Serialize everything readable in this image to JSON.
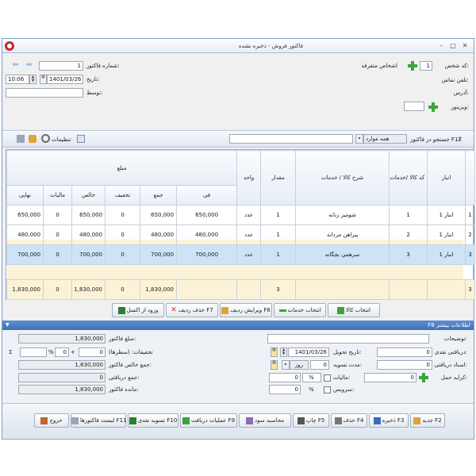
{
  "window": {
    "title": "فاکتور فروش - ذخیره نشده"
  },
  "header": {
    "customer_code_label": "کد شخص:",
    "customer_code_value": "1",
    "customer_name_value": "اشخاص متفرقه",
    "customer_phone_label": "تلفن تماس:",
    "address_label": "آدرس:",
    "visitor_label": "ویزیتور:",
    "invoice_no_label": "شماره فاکتور:",
    "invoice_no_value": "1",
    "date_label": "تاریخ:",
    "date_value": "1401/03/26",
    "time_value": "10:06",
    "by_label": "توسط:"
  },
  "toolbar": {
    "search_label": "جستجو در فاکتور F12",
    "scope_value": "همه موارد",
    "settings_label": "تنظیمات"
  },
  "grid": {
    "group_header": "مبلغ",
    "columns": {
      "warehouse": "انبار",
      "code": "کد کالا /خدمات",
      "desc": "شرح کالا / خدمات",
      "qty": "مقدار",
      "unit": "واحد",
      "fee": "فی",
      "total": "جمع",
      "discount": "تخفیف",
      "net": "خالص",
      "tax": "مالیات",
      "final": "نهایی"
    },
    "rows": [
      {
        "idx": "1",
        "warehouse": "انبار 1",
        "code": "1",
        "desc": "شومیز زنانه",
        "qty": "1",
        "unit": "عدد",
        "fee": "650,000",
        "total": "650,000",
        "discount": "0",
        "net": "650,000",
        "tax": "0",
        "final": "650,000"
      },
      {
        "idx": "2",
        "warehouse": "انبار 1",
        "code": "2",
        "desc": "پیراهن مردانه",
        "qty": "1",
        "unit": "عدد",
        "fee": "480,000",
        "total": "480,000",
        "discount": "0",
        "net": "480,000",
        "tax": "0",
        "final": "480,000"
      },
      {
        "idx": "3",
        "warehouse": "انبار 1",
        "code": "3",
        "desc": "سرهمي بچگانه",
        "qty": "1",
        "unit": "عدد",
        "fee": "700,000",
        "total": "700,000",
        "discount": "0",
        "net": "700,000",
        "tax": "0",
        "final": "700,000"
      }
    ],
    "summary": {
      "count": "3",
      "qty": "3",
      "total": "1,830,000",
      "discount": "0",
      "net": "1,830,000",
      "tax": "0",
      "final": "1,830,000"
    }
  },
  "row_buttons": {
    "select_item": "انتخاب کالا",
    "select_service": "انتخاب خدمات",
    "edit_row": "ویرایش ردیف F6",
    "delete_row": "حذف ردیف F7",
    "import_excel": "ورود از اکسل"
  },
  "more_info": {
    "label": "F8 اطلاعات بیشتر"
  },
  "footer": {
    "description_label": "توضیحات:",
    "cash_label": "دریافتی نقدی:",
    "cash_value": "0",
    "cheque_label": "اسناد دریافتی:",
    "cheque_value": "0",
    "freight_label": "کرایه حمل:",
    "freight_value": "0",
    "delivery_date_label": "تاریخ تحویل:",
    "delivery_date_value": "1401/03/26",
    "settle_label": "مدت تسویه:",
    "settle_value": "0",
    "settle_unit": "روز",
    "tax_label": "مالیات:",
    "tax_value": "0",
    "tax_pct": "%",
    "service_label": "سرویس:",
    "service_value": "0",
    "service_pct": "%",
    "invoice_amount_label": "مبلغ فاکتور:",
    "invoice_amount_value": "1,830,000",
    "discounts_label": "تخفیفات: (سطرها)",
    "discount_value_a": "0",
    "discount_value_b": "0",
    "discount_pct": "%",
    "discount_plus": "+",
    "sigma": "Σ",
    "net_total_label": "جمع خالص فاکتور:",
    "net_total_value": "1,830,000",
    "received_total_label": "جمع دریافتی:",
    "received_total_value": "0",
    "remaining_label": "مانده فاکتور:",
    "remaining_value": "1,830,000"
  },
  "actions": {
    "new": "جدید F2",
    "save": "ذخیره F3",
    "delete": "حذف F4",
    "print": "چاپ F5",
    "profit": "محاسبه سود",
    "receipts": "عملیات دریافت F9",
    "cash_settle": "تسویه نقدی F10",
    "invoice_list": "لیست فاکتورها F11",
    "exit": "خروج"
  },
  "colors": {
    "selected_row": "#cde4f7",
    "empty_rows": "#fbf3d8",
    "section_bar": "#4a7cc0",
    "accent_green": "#3aa53a"
  }
}
